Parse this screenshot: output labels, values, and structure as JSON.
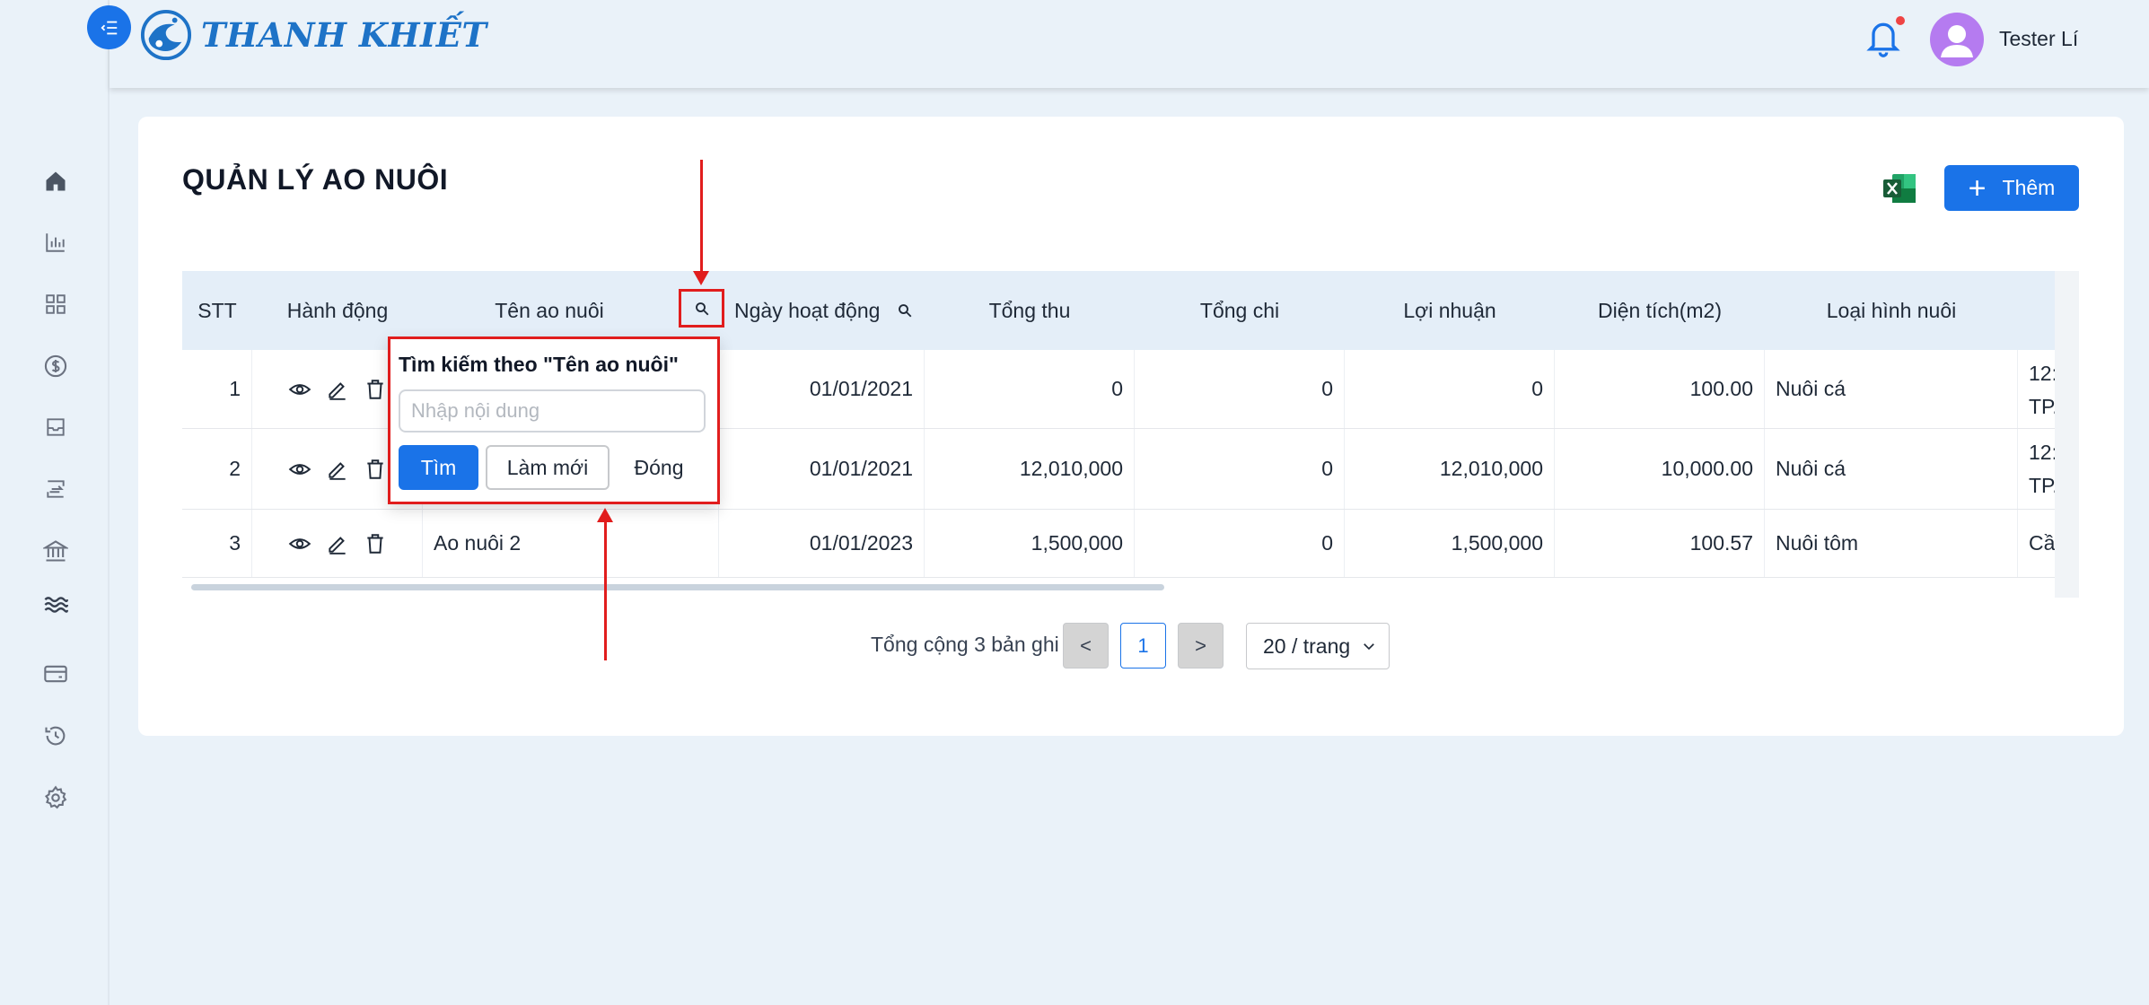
{
  "app": {
    "logo_text": "THANH KHIẾT",
    "user_name": "Tester Lí",
    "notification_dot": true,
    "accent_color": "#1a73e8",
    "annotation_color": "#e11d1d"
  },
  "sidebar": {
    "items": [
      {
        "icon": "home-icon"
      },
      {
        "icon": "bar-chart-icon"
      },
      {
        "icon": "grid-icon"
      },
      {
        "icon": "dollar-icon"
      },
      {
        "icon": "inbox-icon"
      },
      {
        "icon": "transfer-icon"
      },
      {
        "icon": "bank-icon"
      },
      {
        "icon": "waves-icon"
      },
      {
        "icon": "wallet-icon"
      },
      {
        "icon": "history-icon"
      },
      {
        "icon": "gear-icon"
      }
    ]
  },
  "page": {
    "title": "QUẢN LÝ AO NUÔI",
    "add_label": "Thêm"
  },
  "table": {
    "headers": {
      "stt": "STT",
      "actions": "Hành động",
      "name": "Tên ao nuôi",
      "date": "Ngày hoạt động",
      "revenue": "Tổng thu",
      "expense": "Tổng chi",
      "profit": "Lợi nhuận",
      "area": "Diện tích(m2)",
      "type": "Loại hình nuôi"
    },
    "rows": [
      {
        "stt": "1",
        "name": "",
        "date": "01/01/2021",
        "revenue": "0",
        "expense": "0",
        "profit": "0",
        "area": "100.00",
        "type": "Nuôi cá",
        "addr1": "12:",
        "addr2": "TP."
      },
      {
        "stt": "2",
        "name": "",
        "date": "01/01/2021",
        "revenue": "12,010,000",
        "expense": "0",
        "profit": "12,010,000",
        "area": "10,000.00",
        "type": "Nuôi cá",
        "addr1": "12:",
        "addr2": "TP."
      },
      {
        "stt": "3",
        "name": "Ao nuôi 2",
        "date": "01/01/2023",
        "revenue": "1,500,000",
        "expense": "0",
        "profit": "1,500,000",
        "area": "100.57",
        "type": "Nuôi tôm",
        "addr1": "Cầi",
        "addr2": ""
      }
    ]
  },
  "pagination": {
    "total_text": "Tổng cộng 3 bản ghi",
    "current_page": "1",
    "page_size": "20 / trang",
    "prev_symbol": "<",
    "next_symbol": ">"
  },
  "filter_popover": {
    "title": "Tìm kiếm theo \"Tên ao nuôi\"",
    "placeholder": "Nhập nội dung",
    "value": "",
    "search_label": "Tìm",
    "reset_label": "Làm mới",
    "close_label": "Đóng"
  }
}
